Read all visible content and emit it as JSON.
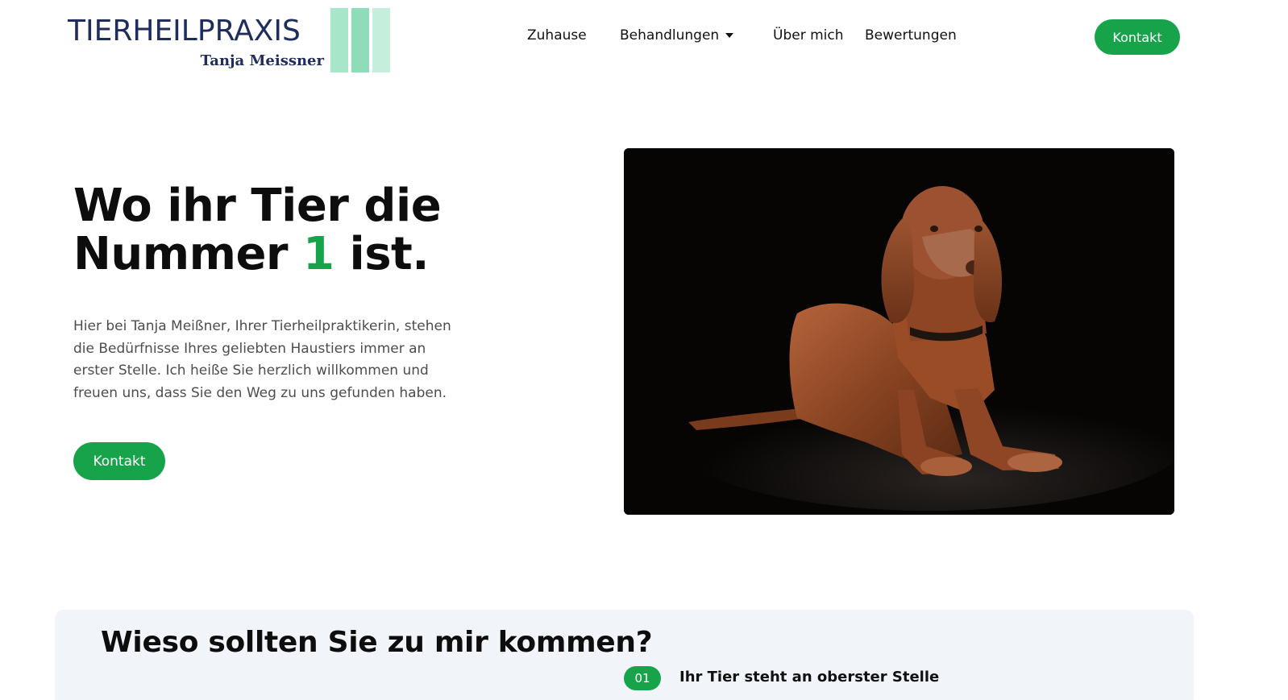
{
  "logo": {
    "title": "TIERHEILPRAXIS",
    "subtitle": "Tanja Meissner",
    "colors": [
      "#a8e6c9",
      "#7fd8b0",
      "#c5efdc"
    ]
  },
  "nav": {
    "items": [
      {
        "label": "Zuhause"
      },
      {
        "label": "Behandlungen",
        "has_dropdown": true
      },
      {
        "label": "Über mich"
      },
      {
        "label": "Bewertungen"
      }
    ],
    "contact_button": "Kontakt"
  },
  "hero": {
    "title_line1": "Wo ihr Tier die",
    "title_line2_before": "Nummer ",
    "title_number": "1",
    "title_line2_after": " ist.",
    "text": "Hier bei Tanja Meißner, Ihrer Tierheilpraktikerin, stehen die Bedürfnisse Ihres geliebten Haustiers immer an erster Stelle. Ich heiße Sie herzlich willkommen und freuen uns, dass Sie den Weg zu uns gefunden haben.",
    "button": "Kontakt",
    "image_icon": "dog-photo"
  },
  "why": {
    "title": "Wieso sollten Sie zu mir kommen?",
    "features": [
      {
        "number": "01",
        "title": "Ihr Tier steht an oberster Stelle"
      }
    ]
  },
  "colors": {
    "accent": "#17a34a",
    "brand_navy": "#1f2d5c",
    "section_bg": "#f1f4f9"
  }
}
